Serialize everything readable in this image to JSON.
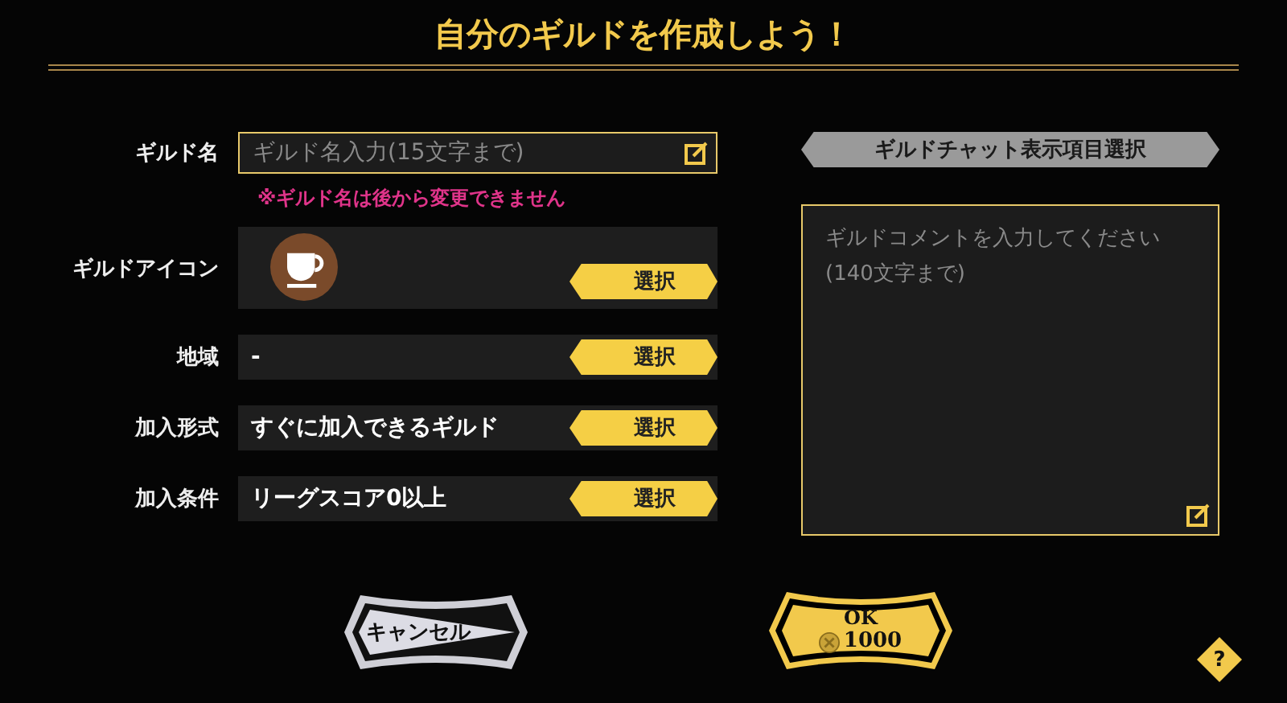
{
  "title": "自分のギルドを作成しよう！",
  "guild_name": {
    "label": "ギルド名",
    "placeholder": "ギルド名入力(15文字まで)",
    "note": "※ギルド名は後から変更できません"
  },
  "settings": [
    {
      "kind": "icon",
      "label": "ギルドアイコン",
      "button": "選択"
    },
    {
      "kind": "text",
      "label": "地域",
      "value": "-",
      "button": "選択"
    },
    {
      "kind": "text",
      "label": "加入形式",
      "value": "すぐに加入できるギルド",
      "button": "選択"
    },
    {
      "kind": "text",
      "label": "加入条件",
      "value": "リーグスコア0以上",
      "button": "選択"
    }
  ],
  "chat_header": "ギルドチャット表示項目選択",
  "comment": {
    "placeholder": "ギルドコメントを入力してください\n(140文字まで)"
  },
  "cancel": "キャンセル",
  "ok": {
    "label": "OK",
    "cost": "1000"
  },
  "help": "?"
}
